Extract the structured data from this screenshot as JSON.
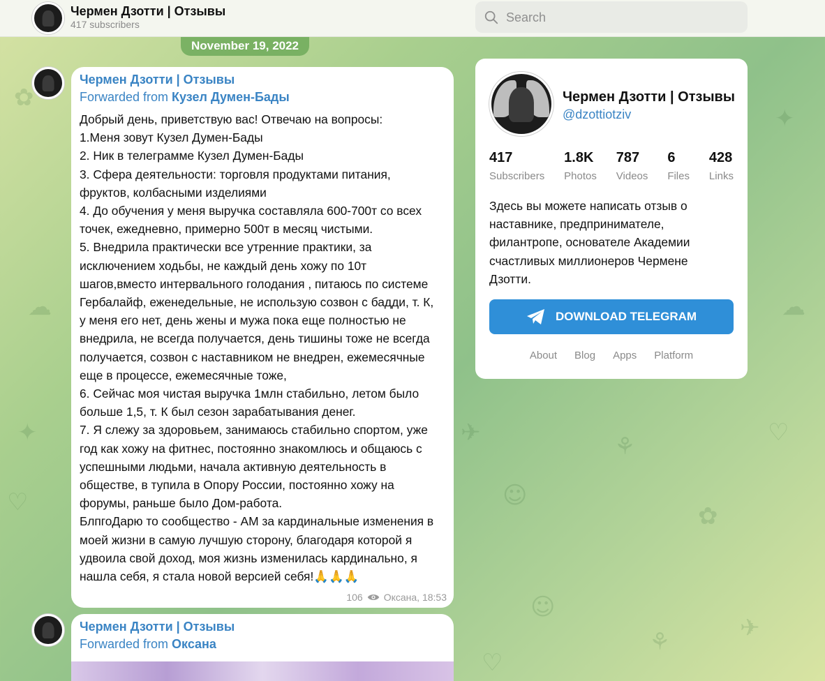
{
  "header": {
    "channel_title": "Чермен Дзотти | Отзывы",
    "subscribers": "417 subscribers",
    "search_placeholder": "Search"
  },
  "date_pill": "November 19, 2022",
  "messages": [
    {
      "author": "Чермен Дзотти | Отзывы",
      "forwarded_prefix": "Forwarded from ",
      "forwarded_from": "Кузел Думен-Бады",
      "lines": [
        "Добрый день, приветствую вас! Отвечаю на вопросы:",
        "1.Меня зовут Кузел Думен-Бады",
        "2. Ник в телеграмме Кузел Думен-Бады",
        "3. Сфера деятельности: торговля продуктами питания,",
        "фруктов, колбасными изделиями",
        "4. До обучения у меня выручка составляла 600-700т со всех",
        "точек, ежедневно, примерно 500т в месяц чистыми.",
        "5. Внедрила практически все утренние практики, за",
        "исключением ходьбы, не каждый день хожу по 10т",
        "шагов,вместо интервального голодания , питаюсь по системе",
        "Гербалайф, еженедельные, не использую созвон с бадди, т. К,",
        "у меня его нет, день жены и мужа пока еще полностью не",
        "внедрила, не всегда получается, день тишины тоже не всегда",
        "получается, созвон с наставником не внедрен, ежемесячные",
        "еще в процессе, ежемесячные тоже,",
        "6. Сейчас моя чистая выручка 1млн стабильно, летом было",
        "больше 1,5, т. К был сезон зарабатывания денег.",
        "7. Я слежу за здоровьем, занимаюсь стабильно спортом, уже",
        "год как хожу на фитнес, постоянно знакомлюсь и общаюсь с",
        "успешными людьми, начала активную деятельность в",
        "обществе, в тупила в Опору России, постоянно хожу на",
        "форумы, раньше было Дом-работа.",
        "БлпгоДарю то сообщество - АМ за кардинальные изменения в",
        "моей жизни в самую лучшую сторону, благодаря которой я",
        "удвоила свой доход, моя жизнь изменилась кардинально, я",
        "нашла себя, я стала новой версией себя!🙏🙏🙏"
      ],
      "views": "106",
      "signature_time": "Оксана, 18:53"
    },
    {
      "author": "Чермен Дзотти | Отзывы",
      "forwarded_prefix": "Forwarded from ",
      "forwarded_from": "Оксана"
    }
  ],
  "panel": {
    "title": "Чермен Дзотти | Отзывы",
    "username": "@dzottiotziv",
    "stats": [
      {
        "num": "417",
        "label": "Subscribers"
      },
      {
        "num": "1.8K",
        "label": "Photos"
      },
      {
        "num": "787",
        "label": "Videos"
      },
      {
        "num": "6",
        "label": "Files"
      },
      {
        "num": "428",
        "label": "Links"
      }
    ],
    "description": "Здесь вы можете написать отзыв о наставнике, предпринимателе, филантропе, основателе Академии счастливых миллионеров Чермене Дзотти.",
    "download_button": "DOWNLOAD TELEGRAM",
    "footer_links": [
      "About",
      "Blog",
      "Apps",
      "Platform"
    ]
  },
  "colors": {
    "accent": "#3a84c4",
    "button": "#2f8fd8",
    "date_pill": "#6eaa5a"
  }
}
